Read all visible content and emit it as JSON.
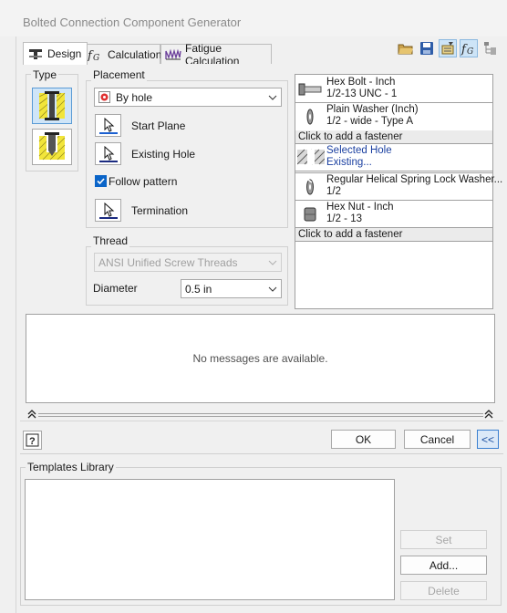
{
  "window": {
    "title": "Bolted Connection Component Generator"
  },
  "tabs": [
    {
      "label": "Design",
      "icon": "bolt-design-icon",
      "active": true
    },
    {
      "label": "Calculation",
      "icon": "fx-icon",
      "active": false
    },
    {
      "label": "Fatigue Calculation",
      "icon": "wave-icon",
      "active": false
    }
  ],
  "toolbar": {
    "icons": [
      "open-folder-icon",
      "save-icon",
      "edit-properties-icon",
      "fx-toggle-icon",
      "tree-icon"
    ]
  },
  "type_group": {
    "label": "Type"
  },
  "placement": {
    "label": "Placement",
    "method": "By hole",
    "start_plane": "Start Plane",
    "existing_hole": "Existing Hole",
    "follow_pattern": "Follow pattern",
    "follow_pattern_checked": true,
    "termination": "Termination"
  },
  "thread": {
    "label": "Thread",
    "type": "ANSI Unified Screw Threads",
    "diameter_label": "Diameter",
    "diameter": "0.5 in"
  },
  "fasteners": {
    "add_label": "Click to add a fastener",
    "top": [
      {
        "name": "Hex Bolt - Inch",
        "spec": "1/2-13 UNC - 1"
      },
      {
        "name": "Plain Washer (Inch)",
        "spec": "1/2 - wide - Type A"
      }
    ],
    "hole": {
      "name": "Selected Hole",
      "spec": "Existing..."
    },
    "bottom": [
      {
        "name": "Regular Helical Spring Lock Washer...",
        "spec": "1/2"
      },
      {
        "name": "Hex Nut - Inch",
        "spec": "1/2 - 13"
      }
    ]
  },
  "messages": {
    "text": "No messages are available."
  },
  "buttons": {
    "ok": "OK",
    "cancel": "Cancel",
    "more": "<<",
    "help": "?"
  },
  "templates": {
    "label": "Templates Library",
    "set": "Set",
    "add": "Add...",
    "delete": "Delete"
  },
  "colors": {
    "accent": "#0a64c8",
    "selected_bg": "#cfe5f8",
    "blue_text": "#1a3fa0",
    "hatch_yellow": "#f2e53a"
  }
}
